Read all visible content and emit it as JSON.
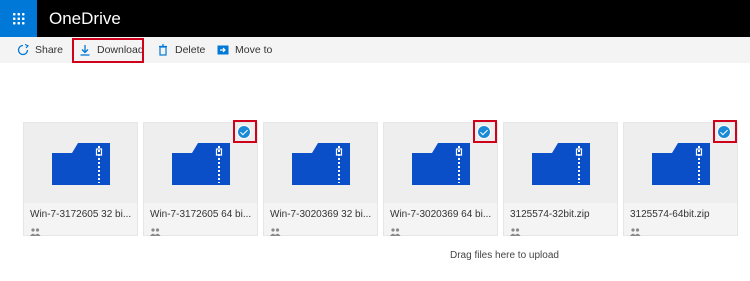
{
  "app": {
    "title": "OneDrive",
    "launcher_icon": "waffle-icon",
    "accent": "#0078d7"
  },
  "toolbar": {
    "share_label": "Share",
    "download_label": "Download",
    "delete_label": "Delete",
    "move_label": "Move to"
  },
  "files": [
    {
      "name": "Win-7-3172605 32 bi...",
      "selected": false
    },
    {
      "name": "Win-7-3172605 64 bi...",
      "selected": true
    },
    {
      "name": "Win-7-3020369 32 bi...",
      "selected": false
    },
    {
      "name": "Win-7-3020369 64 bi...",
      "selected": true
    },
    {
      "name": "3125574-32bit.zip",
      "selected": false
    },
    {
      "name": "3125574-64bit.zip",
      "selected": true
    }
  ],
  "upload_hint": "Drag files here to upload",
  "colors": {
    "highlight": "#d0021b",
    "folder": "#0a4fc8",
    "check": "#1b8ad7"
  }
}
